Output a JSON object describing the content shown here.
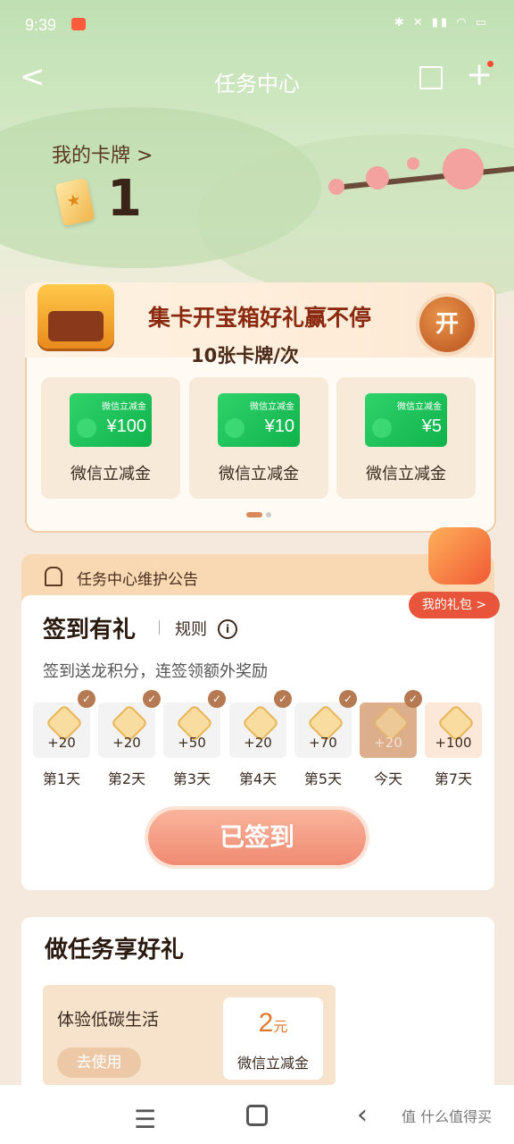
{
  "status": {
    "time": "9:39",
    "icons": "✱ ✕ ▮▮ ◠ ▭"
  },
  "nav": {
    "back": "<",
    "title": "任务中心",
    "plus": "+"
  },
  "cards": {
    "label": "我的卡牌 >",
    "count": "1"
  },
  "box": {
    "title": "集卡开宝箱好礼赢不停",
    "subtitle": "10张卡牌/次",
    "open": "开",
    "prizes": [
      {
        "voucher_title": "微信立减金",
        "amount": "¥100",
        "name": "微信立减金"
      },
      {
        "voucher_title": "微信立减金",
        "amount": "¥10",
        "name": "微信立减金"
      },
      {
        "voucher_title": "微信立减金",
        "amount": "¥5",
        "name": "微信立减金"
      }
    ]
  },
  "notice": {
    "text": "任务中心维护公告"
  },
  "gift": {
    "label": "我的礼包 >"
  },
  "checkin": {
    "title": "签到有礼",
    "rule": "规则",
    "info": "i",
    "desc": "签到送龙积分，连签领额外奖励",
    "days": [
      {
        "pts": "+20",
        "label": "第1天",
        "checked": true
      },
      {
        "pts": "+20",
        "label": "第2天",
        "checked": true
      },
      {
        "pts": "+50",
        "label": "第3天",
        "checked": true
      },
      {
        "pts": "+20",
        "label": "第4天",
        "checked": true
      },
      {
        "pts": "+70",
        "label": "第5天",
        "checked": true
      },
      {
        "pts": "+20",
        "label": "今天",
        "checked": true
      },
      {
        "pts": "+100",
        "label": "第7天",
        "checked": false
      }
    ],
    "button": "已签到"
  },
  "tasks": {
    "title": "做任务享好礼",
    "item": {
      "name": "体验低碳生活",
      "button": "去使用",
      "amount": "2",
      "unit": "元",
      "reward_name": "微信立减金"
    }
  },
  "watermark": "值 什么值得买",
  "colors": {
    "accent": "#e9553a",
    "voucher_green": "#10b24c",
    "brown": "#8a2a10"
  }
}
